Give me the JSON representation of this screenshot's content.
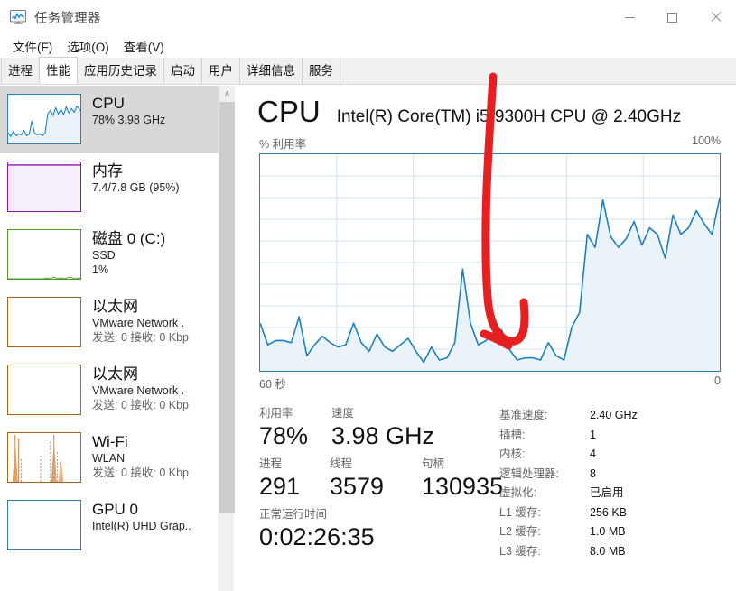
{
  "window": {
    "title": "任务管理器",
    "icon": "task-manager-monitor-icon",
    "minimize_label": "最小化",
    "maximize_label": "最大化",
    "close_label": "关闭"
  },
  "menu": {
    "items": [
      {
        "label": "文件(F)"
      },
      {
        "label": "选项(O)"
      },
      {
        "label": "查看(V)"
      }
    ]
  },
  "tabs": {
    "active": "性能",
    "items": [
      {
        "label": "进程",
        "active": false
      },
      {
        "label": "性能",
        "active": true
      },
      {
        "label": "应用历史记录",
        "active": false
      },
      {
        "label": "启动",
        "active": false
      },
      {
        "label": "用户",
        "active": false
      },
      {
        "label": "详细信息",
        "active": false
      },
      {
        "label": "服务",
        "active": false
      }
    ]
  },
  "sidebar": {
    "items": [
      {
        "name": "cpu",
        "title": "CPU",
        "sub1": "78%  3.98 GHz",
        "sub2": "",
        "selected": true,
        "color": "#2a7fb8"
      },
      {
        "name": "memory",
        "title": "内存",
        "sub1": "7.4/7.8 GB (95%)",
        "sub2": "",
        "selected": false,
        "color": "#8c1aa8"
      },
      {
        "name": "disk-0",
        "title": "磁盘 0 (C:)",
        "sub1": "SSD",
        "sub2": "1%",
        "selected": false,
        "color": "#4e9b27"
      },
      {
        "name": "ethernet-1",
        "title": "以太网",
        "sub1": "VMware Network .",
        "sub2": "发送: 0 接收: 0 Kbp",
        "selected": false,
        "color": "#b45f13"
      },
      {
        "name": "ethernet-2",
        "title": "以太网",
        "sub1": "VMware Network .",
        "sub2": "发送: 0 接收: 0 Kbp",
        "selected": false,
        "color": "#b45f13"
      },
      {
        "name": "wifi",
        "title": "Wi-Fi",
        "sub1": "WLAN",
        "sub2": "发送: 0 接收: 0 Kbp",
        "selected": false,
        "color": "#b45f13"
      },
      {
        "name": "gpu-0",
        "title": "GPU 0",
        "sub1": "Intel(R) UHD Grap..",
        "sub2": "",
        "selected": false,
        "color": "#2a7fb8"
      }
    ]
  },
  "scrollbar": {
    "up_arrow": "˄"
  },
  "main": {
    "title": "CPU",
    "model": "Intel(R) Core(TM) i5-9300H CPU @ 2.40GHz",
    "chart_label_left": "% 利用率",
    "chart_label_right": "100%",
    "chart_time_left": "60 秒",
    "chart_time_right": "0",
    "stats": {
      "utilization_label": "利用率",
      "utilization_value": "78%",
      "speed_label": "速度",
      "speed_value": "3.98 GHz",
      "processes_label": "进程",
      "processes_value": "291",
      "threads_label": "线程",
      "threads_value": "3579",
      "handles_label": "句柄",
      "handles_value": "130935",
      "uptime_label": "正常运行时间",
      "uptime_value": "0:02:26:35"
    },
    "specs": [
      {
        "key": "基准速度:",
        "value": "2.40 GHz"
      },
      {
        "key": "插槽:",
        "value": "1"
      },
      {
        "key": "内核:",
        "value": "4"
      },
      {
        "key": "逻辑处理器:",
        "value": "8"
      },
      {
        "key": "虚拟化:",
        "value": "已启用"
      },
      {
        "key": "L1 缓存:",
        "value": "256 KB"
      },
      {
        "key": "L2 缓存:",
        "value": "1.0 MB"
      },
      {
        "key": "L3 缓存:",
        "value": "8.0 MB"
      }
    ]
  },
  "annotation": {
    "type": "hand-drawn-arrow",
    "color": "#e62020",
    "description": "红色手绘箭头指向 CPU 利用率图表中部"
  },
  "chart_data": {
    "type": "line",
    "title": "% 利用率",
    "xlabel": "60 秒",
    "ylabel": "% 利用率",
    "ylim": [
      0,
      100
    ],
    "xlim": [
      60,
      0
    ],
    "grid": true,
    "legend": "none",
    "line_color": "#1a7fc1",
    "fill_color": "#eaf2fa",
    "series": [
      {
        "name": "CPU 利用率",
        "values": [
          22,
          12,
          14,
          14,
          13,
          25,
          7,
          12,
          16,
          13,
          11,
          12,
          22,
          13,
          9,
          17,
          11,
          9,
          12,
          15,
          9,
          4,
          11,
          5,
          6,
          13,
          47,
          22,
          12,
          14,
          18,
          19,
          10,
          5,
          6,
          6,
          5,
          13,
          7,
          5,
          20,
          27,
          63,
          57,
          79,
          62,
          57,
          61,
          69,
          58,
          66,
          63,
          52,
          72,
          63,
          66,
          74,
          68,
          63,
          80
        ]
      }
    ]
  }
}
